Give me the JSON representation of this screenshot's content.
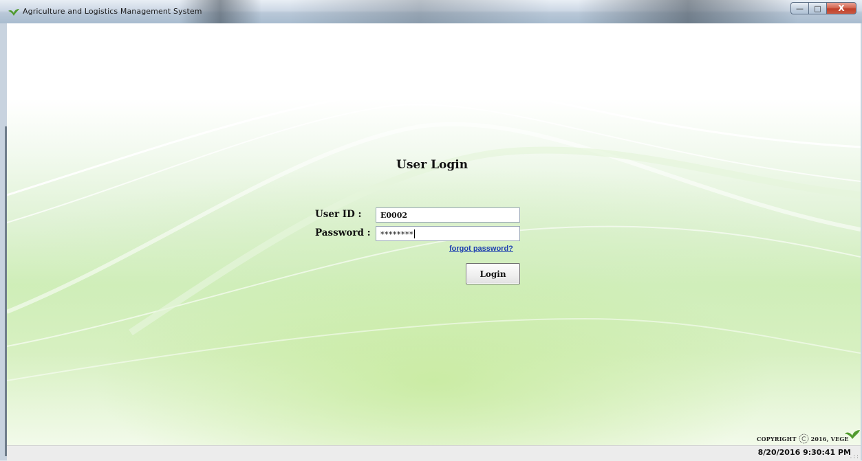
{
  "window": {
    "title": "Agriculture and Logistics Management System",
    "icon": "leaf-icon",
    "controls": {
      "minimize": "minimize-icon",
      "maximize": "maximize-icon",
      "close": "close-icon"
    }
  },
  "login": {
    "title": "User Login",
    "user_id_label": "User ID :",
    "user_id_value": "E0002",
    "password_label": "Password :",
    "password_value": "********",
    "forgot_link": "forgot password?",
    "login_button": "Login"
  },
  "footer": {
    "copyright_word": "COPYRIGHT",
    "copyright_rest": "2016, VEGE",
    "copyright_icon": "copyright-icon",
    "brand_icon": "leaf-icon"
  },
  "status": {
    "datetime": "8/20/2016 9:30:41 PM"
  },
  "colors": {
    "accent_green": "#5aa03c",
    "link_blue": "#1e3fb0",
    "close_red": "#c0402a"
  }
}
